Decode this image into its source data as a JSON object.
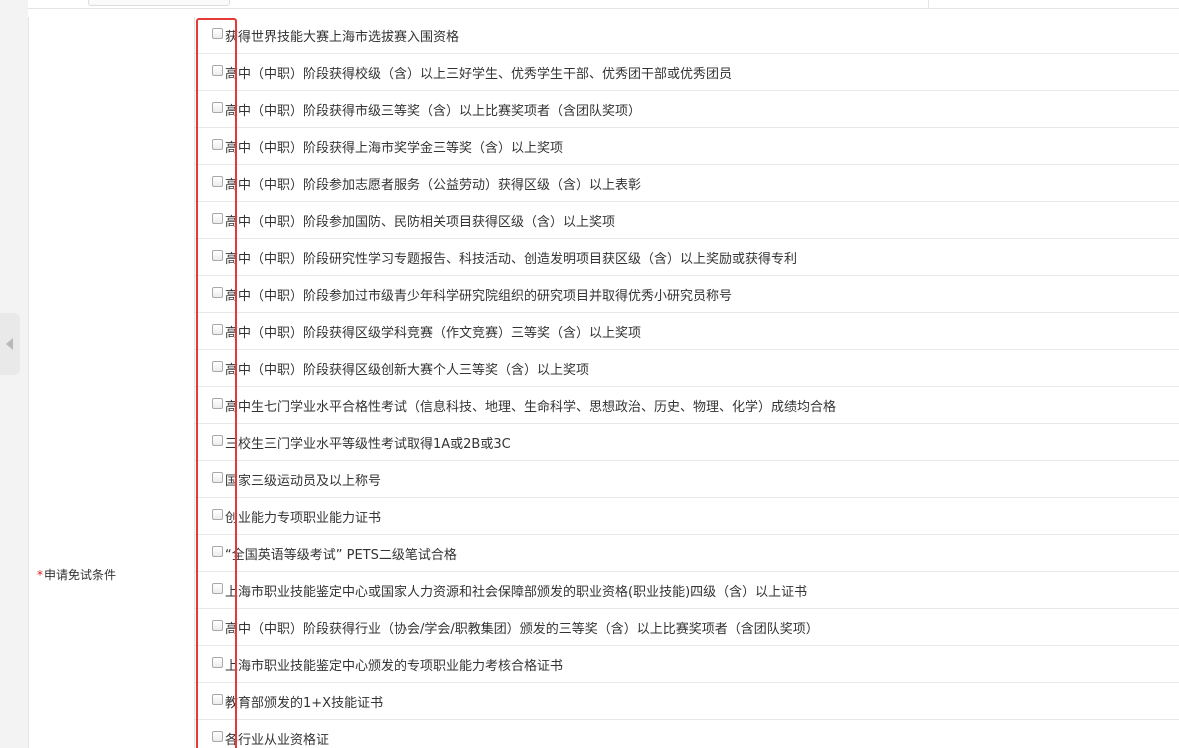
{
  "form": {
    "field_label": "申请免试条件",
    "required_mark": "*",
    "options": [
      {
        "label": "获得世界技能大赛上海市选拔赛入围资格",
        "checked": false
      },
      {
        "label": "高中（中职）阶段获得校级（含）以上三好学生、优秀学生干部、优秀团干部或优秀团员",
        "checked": false
      },
      {
        "label": "高中（中职）阶段获得市级三等奖（含）以上比赛奖项者（含团队奖项）",
        "checked": false
      },
      {
        "label": "高中（中职）阶段获得上海市奖学金三等奖（含）以上奖项",
        "checked": false
      },
      {
        "label": "高中（中职）阶段参加志愿者服务（公益劳动）获得区级（含）以上表彰",
        "checked": false
      },
      {
        "label": "高中（中职）阶段参加国防、民防相关项目获得区级（含）以上奖项",
        "checked": false
      },
      {
        "label": "高中（中职）阶段研究性学习专题报告、科技活动、创造发明项目获区级（含）以上奖励或获得专利",
        "checked": false
      },
      {
        "label": "高中（中职）阶段参加过市级青少年科学研究院组织的研究项目并取得优秀小研究员称号",
        "checked": false
      },
      {
        "label": "高中（中职）阶段获得区级学科竞赛（作文竞赛）三等奖（含）以上奖项",
        "checked": false
      },
      {
        "label": "高中（中职）阶段获得区级创新大赛个人三等奖（含）以上奖项",
        "checked": false
      },
      {
        "label": "高中生七门学业水平合格性考试（信息科技、地理、生命科学、思想政治、历史、物理、化学）成绩均合格",
        "checked": false
      },
      {
        "label": "三校生三门学业水平等级性考试取得1A或2B或3C",
        "checked": false
      },
      {
        "label": "国家三级运动员及以上称号",
        "checked": false
      },
      {
        "label": "创业能力专项职业能力证书",
        "checked": false
      },
      {
        "label": "“全国英语等级考试” PETS二级笔试合格",
        "checked": false
      },
      {
        "label": "上海市职业技能鉴定中心或国家人力资源和社会保障部颁发的职业资格(职业技能)四级（含）以上证书",
        "checked": false
      },
      {
        "label": "高中（中职）阶段获得行业（协会/学会/职教集团）颁发的三等奖（含）以上比赛奖项者（含团队奖项）",
        "checked": false
      },
      {
        "label": "上海市职业技能鉴定中心颁发的专项职业能力考核合格证书",
        "checked": false
      },
      {
        "label": "教育部颁发的1+X技能证书",
        "checked": false
      },
      {
        "label": "各行业从业资格证",
        "checked": false
      }
    ]
  },
  "colors": {
    "highlight": "#e53935",
    "required": "#e02020",
    "text": "#333333",
    "divider": "#e8e8e8"
  },
  "icons": {
    "collapse": "chevron-left-icon"
  }
}
